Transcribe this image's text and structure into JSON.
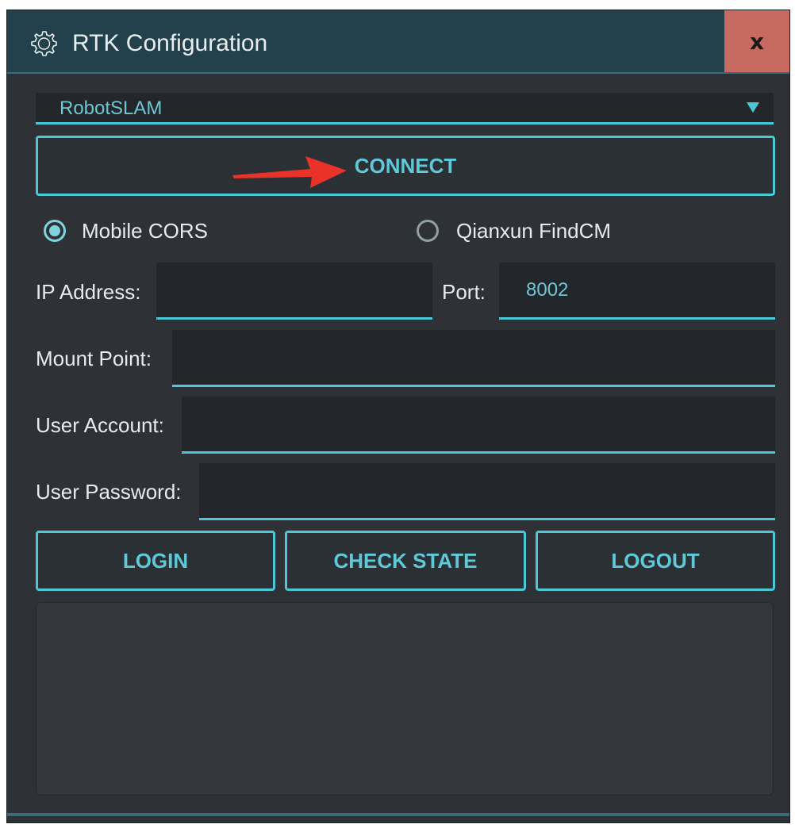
{
  "window": {
    "title": "RTK Configuration",
    "close_label": "x"
  },
  "device_select": {
    "selected": "RobotSLAM"
  },
  "connect_button": {
    "label": "CONNECT"
  },
  "mode": {
    "options": [
      {
        "label": "Mobile CORS",
        "checked": true
      },
      {
        "label": "Qianxun FindCM",
        "checked": false
      }
    ]
  },
  "fields": {
    "ip_address": {
      "label": "IP Address:",
      "value": ""
    },
    "port": {
      "label": "Port:",
      "value": "8002"
    },
    "mount_point": {
      "label": "Mount Point:",
      "value": ""
    },
    "user_account": {
      "label": "User Account:",
      "value": ""
    },
    "user_password": {
      "label": "User Password:",
      "value": ""
    }
  },
  "actions": {
    "login": "LOGIN",
    "check_state": "CHECK STATE",
    "logout": "LOGOUT"
  },
  "colors": {
    "accent": "#4cc7d6",
    "titlebar": "#23414d",
    "close": "#c76a5f",
    "annotation_arrow": "#e8322a"
  }
}
